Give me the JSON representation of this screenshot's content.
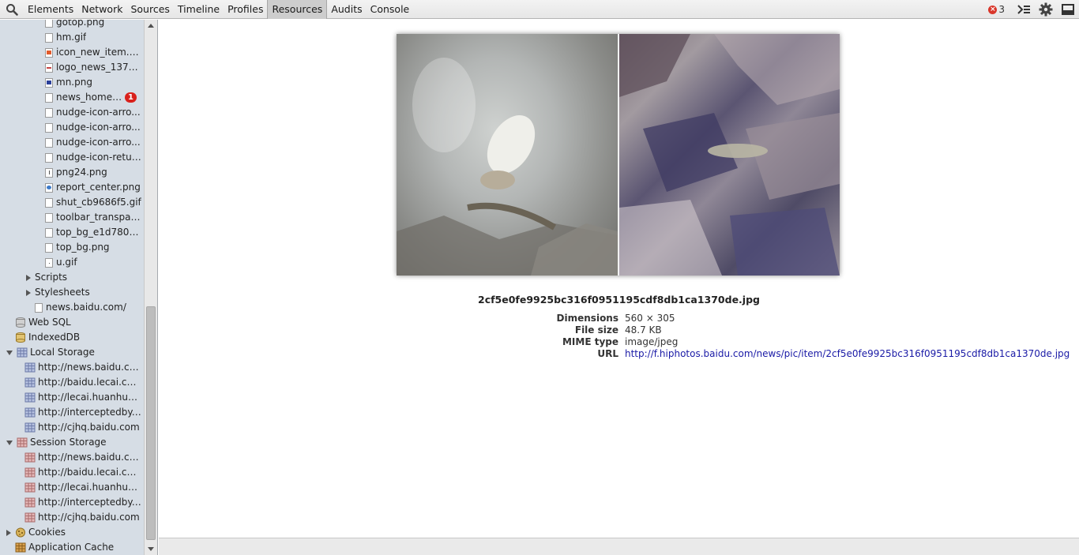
{
  "toolbar": {
    "search_icon": "search-icon",
    "tabs": [
      {
        "label": "Elements"
      },
      {
        "label": "Network"
      },
      {
        "label": "Sources"
      },
      {
        "label": "Timeline"
      },
      {
        "label": "Profiles"
      },
      {
        "label": "Resources",
        "selected": true
      },
      {
        "label": "Audits"
      },
      {
        "label": "Console"
      }
    ],
    "error_count": "3",
    "error_icon": "error-icon",
    "console_icon": "console-drawer-icon",
    "settings_icon": "gear-icon",
    "dock_icon": "dock-icon"
  },
  "sidebar": {
    "image_items": [
      {
        "label": "gotop.png",
        "icon": "file-icon"
      },
      {
        "label": "hm.gif",
        "icon": "file-icon"
      },
      {
        "label": "icon_new_item.png",
        "icon": "image-thumb-icon"
      },
      {
        "label": "logo_news_137_4...",
        "icon": "image-thumb-icon"
      },
      {
        "label": "mn.png",
        "icon": "image-thumb-icon"
      },
      {
        "label": "news_home_a...",
        "icon": "file-icon",
        "badge": "1"
      },
      {
        "label": "nudge-icon-arro...",
        "icon": "file-icon"
      },
      {
        "label": "nudge-icon-arro...",
        "icon": "file-icon"
      },
      {
        "label": "nudge-icon-arro...",
        "icon": "file-icon"
      },
      {
        "label": "nudge-icon-retur...",
        "icon": "file-icon"
      },
      {
        "label": "png24.png",
        "icon": "file-icon"
      },
      {
        "label": "report_center.png",
        "icon": "image-thumb-icon"
      },
      {
        "label": "shut_cb9686f5.gif",
        "icon": "file-icon"
      },
      {
        "label": "toolbar_transpare...",
        "icon": "file-icon"
      },
      {
        "label": "top_bg_e1d7808e....",
        "icon": "file-icon"
      },
      {
        "label": "top_bg.png",
        "icon": "file-icon"
      },
      {
        "label": "u.gif",
        "icon": "file-icon"
      }
    ],
    "scripts_label": "Scripts",
    "stylesheets_label": "Stylesheets",
    "document_label": "news.baidu.com/",
    "web_sql_label": "Web SQL",
    "indexeddb_label": "IndexedDB",
    "local_storage_label": "Local Storage",
    "local_storage_items": [
      {
        "label": "http://news.baidu.com"
      },
      {
        "label": "http://baidu.lecai.com"
      },
      {
        "label": "http://lecai.huanhuba..."
      },
      {
        "label": "http://interceptedby.a..."
      },
      {
        "label": "http://cjhq.baidu.com"
      }
    ],
    "session_storage_label": "Session Storage",
    "session_storage_items": [
      {
        "label": "http://news.baidu.com"
      },
      {
        "label": "http://baidu.lecai.com"
      },
      {
        "label": "http://lecai.huanhuba..."
      },
      {
        "label": "http://interceptedby.a..."
      },
      {
        "label": "http://cjhq.baidu.com"
      }
    ],
    "cookies_label": "Cookies",
    "app_cache_label": "Application Cache"
  },
  "image_view": {
    "filename": "2cf5e0fe9925bc316f0951195cdf8db1ca1370de.jpg",
    "properties": [
      {
        "name": "Dimensions",
        "value": "560 × 305"
      },
      {
        "name": "File size",
        "value": "48.7 KB"
      },
      {
        "name": "MIME type",
        "value": "image/jpeg"
      },
      {
        "name": "URL",
        "value": "http://f.hiphotos.baidu.com/news/pic/item/2cf5e0fe9925bc316f0951195cdf8db1ca1370de.jpg",
        "link": true
      }
    ]
  }
}
